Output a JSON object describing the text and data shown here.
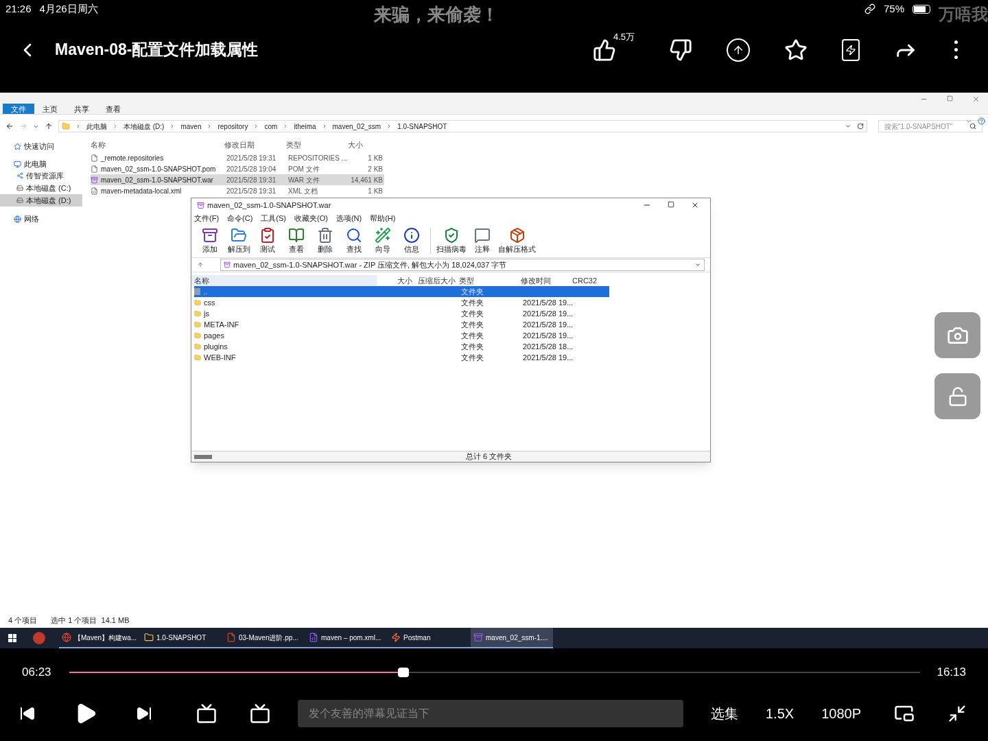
{
  "status_bar": {
    "time": "21:26",
    "date": "4月26日周六",
    "battery": "75%"
  },
  "danmaku": [
    "来骗，来偷袭！",
    "万唔我"
  ],
  "header": {
    "title": "Maven-08-配置文件加载属性",
    "like_count": "4.5万"
  },
  "explorer": {
    "ribbon_tabs": [
      {
        "label": "文件",
        "selected": true
      },
      {
        "label": "主页",
        "selected": false
      },
      {
        "label": "共享",
        "selected": false
      },
      {
        "label": "查看",
        "selected": false
      }
    ],
    "breadcrumb": [
      "此电脑",
      "本地磁盘 (D:)",
      "maven",
      "repository",
      "com",
      "itheima",
      "maven_02_ssm",
      "1.0-SNAPSHOT"
    ],
    "search": {
      "placeholder": "搜索\"1.0-SNAPSHOT\""
    },
    "sidebar": [
      {
        "label": "快速访问",
        "kind": "star",
        "selected": false
      },
      {
        "label": "此电脑",
        "kind": "pc",
        "selected": false,
        "children": [
          {
            "label": "传智资源库",
            "kind": "net",
            "selected": false
          },
          {
            "label": "本地磁盘 (C:)",
            "kind": "disk",
            "selected": false
          },
          {
            "label": "本地磁盘 (D:)",
            "kind": "disk",
            "selected": true
          }
        ]
      },
      {
        "label": "网络",
        "kind": "network",
        "selected": false
      }
    ],
    "columns": [
      "名称",
      "修改日期",
      "类型",
      "大小"
    ],
    "files": [
      {
        "name": "_remote.repositories",
        "date": "2021/5/28 19:31",
        "type": "REPOSITORIES ...",
        "size": "1 KB",
        "kind": "file",
        "selected": false
      },
      {
        "name": "maven_02_ssm-1.0-SNAPSHOT.pom",
        "date": "2021/5/28 19:04",
        "type": "POM 文件",
        "size": "2 KB",
        "kind": "file",
        "selected": false
      },
      {
        "name": "maven_02_ssm-1.0-SNAPSHOT.war",
        "date": "2021/5/28 19:31",
        "type": "WAR 文件",
        "size": "14,461 KB",
        "kind": "archive",
        "selected": true
      },
      {
        "name": "maven-metadata-local.xml",
        "date": "2021/5/28 19:31",
        "type": "XML 文档",
        "size": "1 KB",
        "kind": "xml",
        "selected": false
      }
    ],
    "status": [
      "4 个项目",
      "选中 1 个项目  14.1 MB"
    ]
  },
  "winrar": {
    "title": "maven_02_ssm-1.0-SNAPSHOT.war",
    "menu": [
      "文件(F)",
      "命令(C)",
      "工具(S)",
      "收藏夹(O)",
      "选项(N)",
      "帮助(H)"
    ],
    "toolbar": [
      {
        "label": "添加",
        "kind": "add"
      },
      {
        "label": "解压到",
        "kind": "extract"
      },
      {
        "label": "测试",
        "kind": "test"
      },
      {
        "label": "查看",
        "kind": "view"
      },
      {
        "label": "删除",
        "kind": "delete"
      },
      {
        "label": "查找",
        "kind": "find"
      },
      {
        "label": "向导",
        "kind": "wizard"
      },
      {
        "label": "信息",
        "kind": "info"
      },
      {
        "label": "扫描病毒",
        "kind": "scan"
      },
      {
        "label": "注释",
        "kind": "comment"
      },
      {
        "label": "自解压格式",
        "kind": "sfx"
      }
    ],
    "path": "maven_02_ssm-1.0-SNAPSHOT.war - ZIP 压缩文件, 解包大小为 18,024,037 字节",
    "columns": [
      "名称",
      "大小",
      "压缩后大小",
      "类型",
      "修改时间",
      "CRC32"
    ],
    "rows": [
      {
        "name": "..",
        "type": "文件夹",
        "modified": "",
        "selected": true,
        "kind": "up"
      },
      {
        "name": "css",
        "type": "文件夹",
        "modified": "2021/5/28 19...",
        "selected": false,
        "kind": "folder"
      },
      {
        "name": "js",
        "type": "文件夹",
        "modified": "2021/5/28 19...",
        "selected": false,
        "kind": "folder"
      },
      {
        "name": "META-INF",
        "type": "文件夹",
        "modified": "2021/5/28 19...",
        "selected": false,
        "kind": "folder"
      },
      {
        "name": "pages",
        "type": "文件夹",
        "modified": "2021/5/28 19...",
        "selected": false,
        "kind": "folder"
      },
      {
        "name": "plugins",
        "type": "文件夹",
        "modified": "2021/5/28 18...",
        "selected": false,
        "kind": "folder"
      },
      {
        "name": "WEB-INF",
        "type": "文件夹",
        "modified": "2021/5/28 19...",
        "selected": false,
        "kind": "folder"
      }
    ],
    "status": "总计 6 文件夹"
  },
  "taskbar": [
    {
      "label": "【Maven】构建wa...",
      "kind": "chrome",
      "selected": false
    },
    {
      "label": "1.0-SNAPSHOT",
      "kind": "folder",
      "selected": false
    },
    {
      "label": "03-Maven进阶.pp...",
      "kind": "ppt",
      "selected": false
    },
    {
      "label": "maven – pom.xml...",
      "kind": "idea",
      "selected": false
    },
    {
      "label": "Postman",
      "kind": "postman",
      "selected": false
    },
    {
      "label": "maven_02_ssm-1....",
      "kind": "rar",
      "selected": true
    }
  ],
  "player": {
    "current": "06:23",
    "total": "16:13",
    "level": 0.393,
    "danmaku_placeholder": "发个友善的弹幕见证当下",
    "episodes": "选集",
    "speed": "1.5X",
    "quality": "1080P"
  }
}
